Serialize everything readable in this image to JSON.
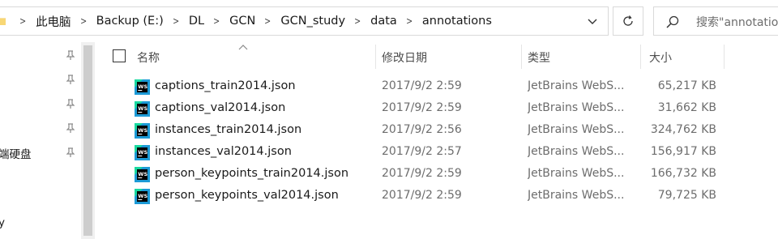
{
  "address": {
    "breadcrumbs": [
      "此电脑",
      "Backup (E:)",
      "DL",
      "GCN",
      "GCN_study",
      "data",
      "annotations"
    ]
  },
  "search": {
    "placeholder": "搜索\"annotations\""
  },
  "nav": {
    "items": [
      {
        "label": ""
      },
      {
        "label": ""
      },
      {
        "label": ""
      },
      {
        "label": ""
      },
      {
        "label": "端硬盘"
      }
    ],
    "bottom_label": "y"
  },
  "columns": {
    "name": "名称",
    "date": "修改日期",
    "type": "类型",
    "size": "大小"
  },
  "files": [
    {
      "name": "captions_train2014.json",
      "date": "2017/9/2 2:59",
      "type": "JetBrains WebStorm",
      "size": "65,217 KB"
    },
    {
      "name": "captions_val2014.json",
      "date": "2017/9/2 2:59",
      "type": "JetBrains WebStorm",
      "size": "31,662 KB"
    },
    {
      "name": "instances_train2014.json",
      "date": "2017/9/2 2:56",
      "type": "JetBrains WebStorm",
      "size": "324,762 KB"
    },
    {
      "name": "instances_val2014.json",
      "date": "2017/9/2 2:57",
      "type": "JetBrains WebStorm",
      "size": "156,917 KB"
    },
    {
      "name": "person_keypoints_train2014.json",
      "date": "2017/9/2 2:59",
      "type": "JetBrains WebStorm",
      "size": "166,732 KB"
    },
    {
      "name": "person_keypoints_val2014.json",
      "date": "2017/9/2 2:59",
      "type": "JetBrains WebStorm",
      "size": "79,725 KB"
    }
  ],
  "colors": {
    "border": "#d9d9d9",
    "ws_icon_bg": "#1c9ad6",
    "ws_icon_accent": "#19d9a0"
  }
}
